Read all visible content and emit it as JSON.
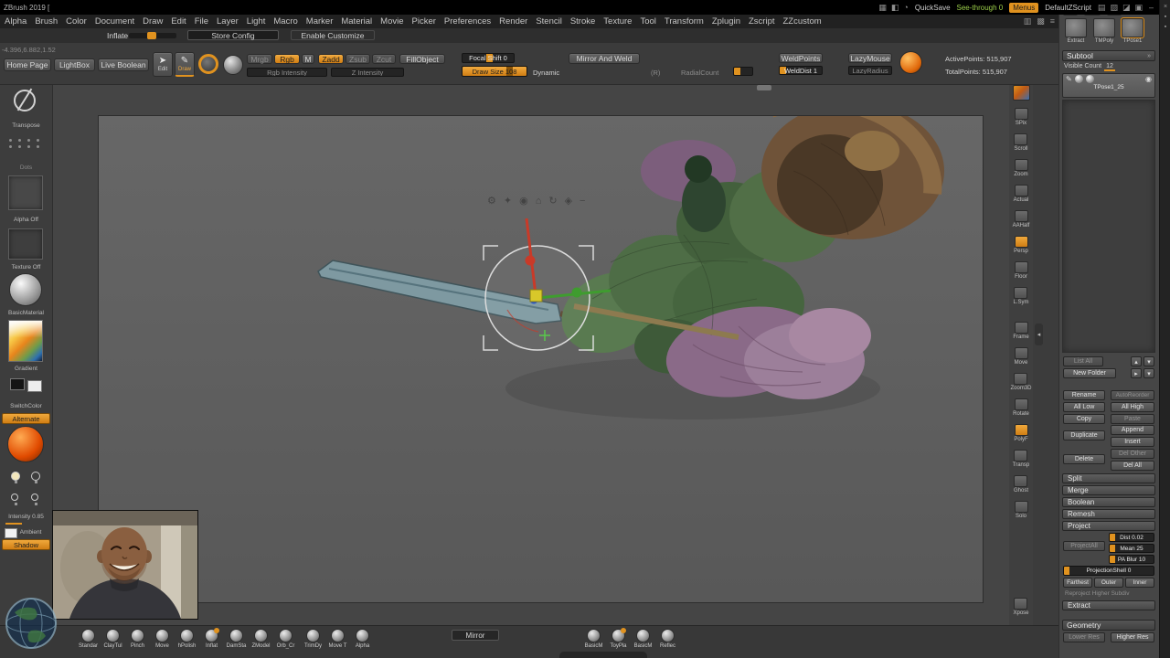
{
  "titlebar": {
    "title": "ZBrush 2019 [",
    "left_icons": [
      {
        "name": "doc-grid-icon",
        "glyph": "▦"
      },
      {
        "name": "panel-icon",
        "glyph": "◧"
      },
      {
        "name": "history-icon",
        "glyph": "◔"
      }
    ],
    "quicksave": "QuickSave",
    "seethrough": "See-through 0",
    "menus_btn": "Menus",
    "defaultzscript": "DefaultZScript",
    "right_icons": [
      {
        "name": "grid-icon",
        "glyph": "▤"
      },
      {
        "name": "layers-icon",
        "glyph": "▨"
      },
      {
        "name": "split-view-icon",
        "glyph": "◪"
      },
      {
        "name": "screen-icon",
        "glyph": "▣"
      }
    ],
    "minimize": "–",
    "close": "×"
  },
  "menubar": {
    "items": [
      "Alpha",
      "Brush",
      "Color",
      "Document",
      "Draw",
      "Edit",
      "File",
      "Layer",
      "Light",
      "Macro",
      "Marker",
      "Material",
      "Movie",
      "Picker",
      "Preferences",
      "Render",
      "Stencil",
      "Stroke",
      "Texture",
      "Tool",
      "Transform",
      "Zplugin",
      "Zscript",
      "ZZcustom"
    ],
    "right_icons": [
      {
        "name": "tool-grid-icon",
        "glyph": "▥"
      },
      {
        "name": "swatch-icon",
        "glyph": "▩"
      },
      {
        "name": "menu-lines-icon",
        "glyph": "≡"
      }
    ]
  },
  "configbar": {
    "inflate": "Inflate",
    "store_config": "Store Config",
    "enable_customize": "Enable Customize"
  },
  "readout": "-4.396,6.882,1.52",
  "topshelf": {
    "home_page": "Home Page",
    "lightbox": "LightBox",
    "live_boolean": "Live Boolean",
    "edit": "Edit",
    "draw": "Draw",
    "mrgb": "Mrgb",
    "rgb": "Rgb",
    "m": "M",
    "zadd": "Zadd",
    "zsub": "Zsub",
    "zcut": "Zcut",
    "fillobject": "FillObject",
    "rgb_intensity": "Rgb Intensity",
    "z_intensity": "Z Intensity",
    "focal_shift": "Focal Shift 0",
    "draw_size": "Draw Size 108",
    "dynamic": "Dynamic",
    "mirror_and_weld": "Mirror And Weld",
    "r_label": "(R)",
    "radialcount": "RadialCount",
    "weldpoints": "WeldPoints",
    "welddist": "WeldDist 1",
    "lazymouse": "LazyMouse",
    "lazyradius": "LazyRadius",
    "activepoints": "ActivePoints: 515,907",
    "totalpoints": "TotalPoints: 515,907"
  },
  "leftshelf": {
    "transpose": "Transpose",
    "dots": "Dots",
    "alpha_off": "Alpha Off",
    "texture_off": "Texture Off",
    "basic_material": "BasicMaterial",
    "gradient": "Gradient",
    "switch_color": "SwitchColor",
    "alternate": "Alternate",
    "intensity": "Intensity 0.85",
    "ambient": "Ambient",
    "shadow": "Shadow"
  },
  "canvas": {
    "mini_toolbar": [
      {
        "name": "gear-icon",
        "glyph": "⚙"
      },
      {
        "name": "star-icon",
        "glyph": "✦"
      },
      {
        "name": "pivot-icon",
        "glyph": "◉"
      },
      {
        "name": "home-icon",
        "glyph": "⌂"
      },
      {
        "name": "orbit-icon",
        "glyph": "↻"
      },
      {
        "name": "lock-icon",
        "glyph": "◈"
      },
      {
        "name": "collapse-icon",
        "glyph": "−"
      }
    ]
  },
  "rightshelf": {
    "items": [
      {
        "label": "SPix"
      },
      {
        "label": "Scroll"
      },
      {
        "label": "Zoom"
      },
      {
        "label": "Actual"
      },
      {
        "label": "AAHalf"
      },
      {
        "label": "Persp",
        "active": true
      },
      {
        "label": "Floor"
      },
      {
        "label": "L.Sym"
      },
      {
        "label": "Frame",
        "gap": true
      },
      {
        "label": "Move"
      },
      {
        "label": "Zoom3D"
      },
      {
        "label": "Rotate"
      },
      {
        "label": "PolyF",
        "active": true
      },
      {
        "label": "Transp"
      },
      {
        "label": "Ghost"
      },
      {
        "label": "Solo"
      }
    ],
    "xpose": "Xpose"
  },
  "toolpanel": {
    "top_icons": [
      {
        "name": "brush-tool-icon",
        "glyph": "✎"
      },
      {
        "name": "mesh-tool-icon",
        "glyph": "▣"
      },
      {
        "name": "move-tool-icon",
        "glyph": "✦"
      }
    ],
    "thumbs": [
      {
        "label": "Extract"
      },
      {
        "label": "TMPoly"
      },
      {
        "label": "TPose1",
        "active": true
      }
    ],
    "subtool": {
      "header": "Subtool",
      "visible_label": "Visible Count",
      "visible_value": "12",
      "item_name": "TPose1_25",
      "list_all": "List All",
      "new_folder": "New Folder",
      "rename": "Rename",
      "autoreorder": "AutoReorder",
      "all_low": "All Low",
      "all_high": "All High",
      "copy": "Copy",
      "paste": "Paste",
      "duplicate": "Duplicate",
      "append": "Append",
      "insert": "Insert",
      "del_other": "Del Other",
      "delete": "Delete",
      "del_all": "Del All",
      "split": "Split",
      "merge": "Merge",
      "boolean": "Boolean",
      "remesh": "Remesh",
      "project": "Project",
      "projectall": "ProjectAll",
      "dist": "Dist 0.02",
      "mean": "Mean 25",
      "pa_blur": "PA Blur 10",
      "projectionshell": "ProjectionShell 0",
      "farthest": "Farthest",
      "outer": "Outer",
      "inner": "Inner",
      "reproject": "Reproject Higher Subdiv",
      "extract": "Extract",
      "geometry": "Geometry",
      "lower_res": "Lower Res",
      "higher_res": "Higher Res"
    }
  },
  "bottombar": {
    "brushes": [
      {
        "label": "Standar"
      },
      {
        "label": "ClayTul"
      },
      {
        "label": "Pinch"
      },
      {
        "label": "Move"
      },
      {
        "label": "hPolish"
      },
      {
        "label": "Inflat",
        "dot": true
      },
      {
        "label": "DamSta"
      },
      {
        "label": "ZModel"
      },
      {
        "label": "Orb_Cr"
      }
    ],
    "brushes2": [
      {
        "label": "TrimDy"
      },
      {
        "label": "Move T"
      },
      {
        "label": "Alpha"
      }
    ],
    "mirror": "Mirror",
    "materials": [
      {
        "label": "BasicM"
      },
      {
        "label": "ToyPla",
        "dot": true
      },
      {
        "label": "BasicM"
      },
      {
        "label": "Reflec"
      }
    ]
  }
}
